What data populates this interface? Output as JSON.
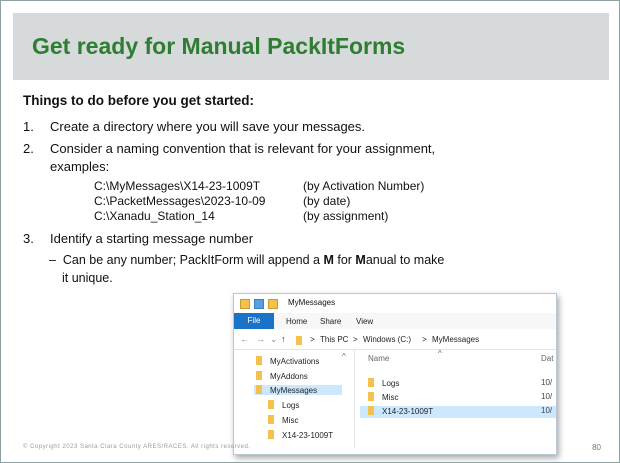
{
  "slide": {
    "title": "Get ready for Manual PackItForms",
    "heading": "Things to do before you get started:",
    "items": [
      {
        "num": "1.",
        "text": "Create a directory where you will save your messages."
      },
      {
        "num": "2.",
        "text": "Consider a naming convention that is relevant for your assignment,",
        "text_cont": "examples:"
      },
      {
        "num": "3.",
        "text": "Identify a starting message number"
      }
    ],
    "examples": [
      {
        "path": "C:\\MyMessages\\X14-23-1009T",
        "note": "(by Activation Number)"
      },
      {
        "path": "C:\\PacketMessages\\2023-10-09",
        "note": "(by date)"
      },
      {
        "path": "C:\\Xanadu_Station_14",
        "note": "(by assignment)"
      }
    ],
    "sub_bullet": {
      "dash": "–",
      "line1_before": "Can be any number; PackItForm will append a ",
      "bold_m1": "M",
      "line1_mid": " for ",
      "bold_m2": "M",
      "line1_after": "anual to make",
      "line2": "it unique."
    },
    "footer_left": "© Copyright 2023 Santa Clara County ARES/RACES. All rights reserved.",
    "page_number": "80"
  },
  "explorer": {
    "title": "MyMessages",
    "ribbon_tabs": [
      "File",
      "Home",
      "Share",
      "View"
    ],
    "nav": {
      "back": "←",
      "forward": "→",
      "down": "⌄",
      "up": "↑"
    },
    "breadcrumb": [
      "This PC",
      "Windows (C:)",
      "MyMessages"
    ],
    "breadcrumb_sep": ">",
    "tree": [
      "MyActivations",
      "MyAddons",
      "MyMessages",
      "Logs",
      "Misc",
      "X14-23-1009T"
    ],
    "columns": {
      "name": "Name",
      "date": "Dat"
    },
    "rows": [
      {
        "name": "Logs",
        "date": "10/"
      },
      {
        "name": "Misc",
        "date": "10/"
      },
      {
        "name": "X14-23-1009T",
        "date": "10/"
      }
    ]
  }
}
